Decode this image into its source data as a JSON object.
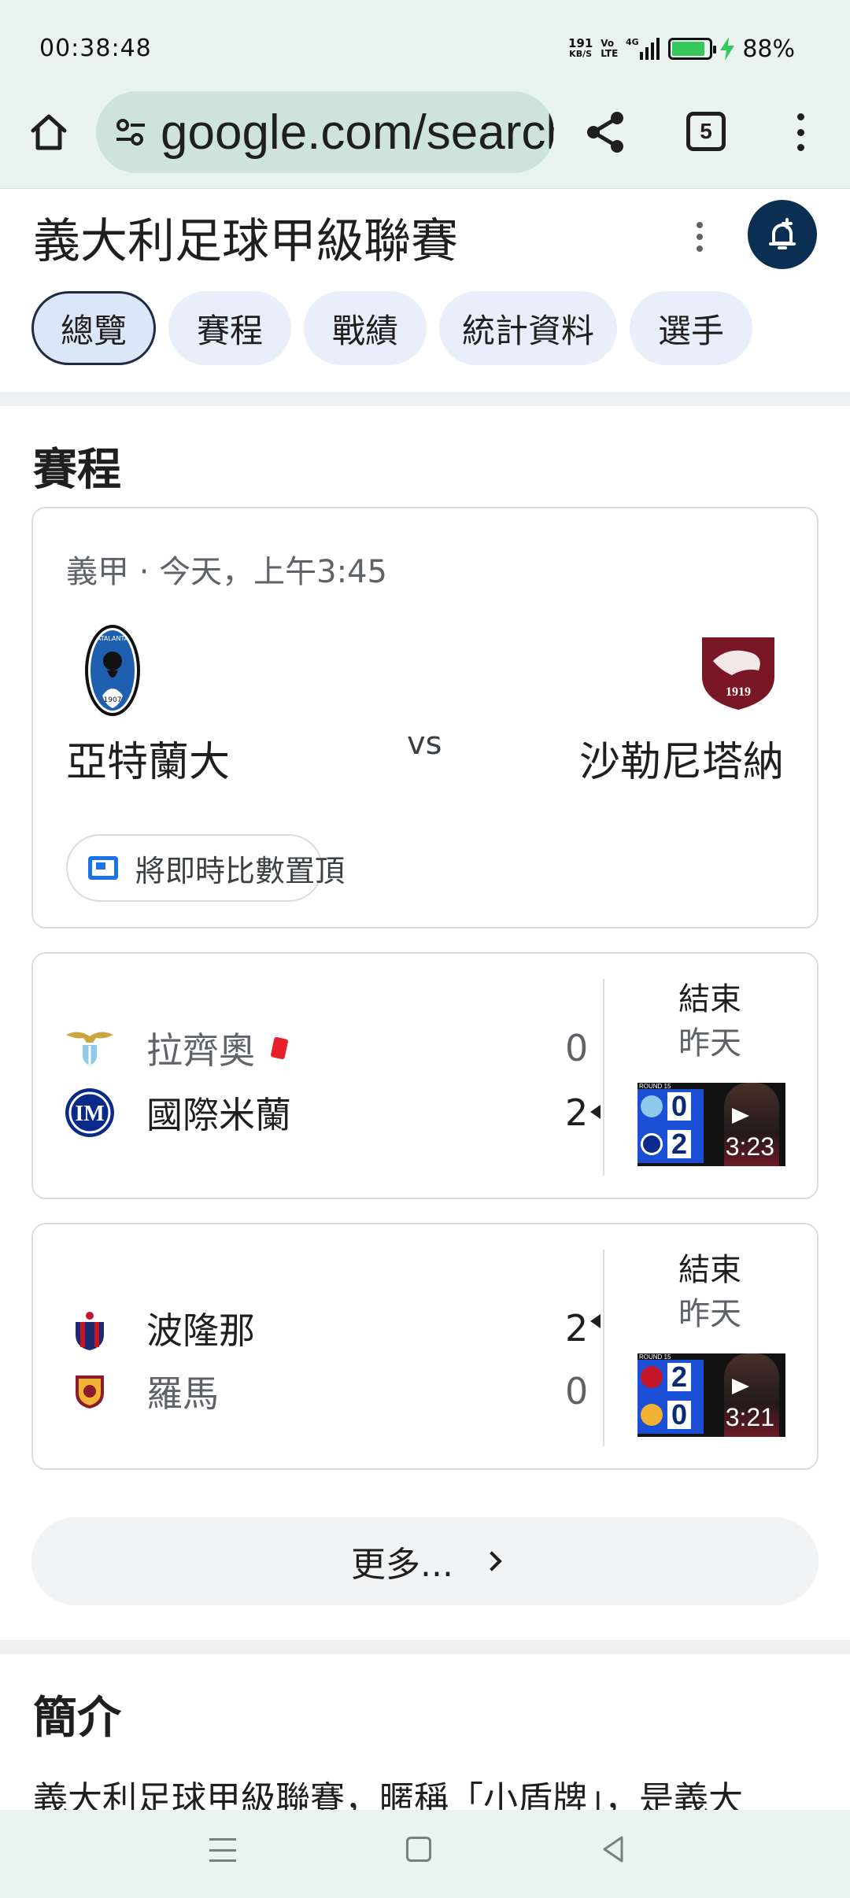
{
  "status_bar": {
    "time": "00:38:48",
    "net_speed": "191",
    "net_unit": "KB/S",
    "volte_top": "Vo",
    "volte_bottom": "LTE",
    "network": "4G",
    "battery_percent": "88%",
    "battery_level": 0.88
  },
  "browser": {
    "url": "google.com/search",
    "tab_count": "5"
  },
  "header": {
    "title": "義大利足球甲級聯賽",
    "chips": [
      "總覽",
      "賽程",
      "戰績",
      "統計資料",
      "選手"
    ],
    "active_chip": 0
  },
  "schedule": {
    "title": "賽程",
    "upcoming": {
      "meta": "義甲 · 今天，上午3:45",
      "home": "亞特蘭大",
      "away": "沙勒尼塔納",
      "vs": "vs",
      "pin_label": "將即時比數置頂",
      "home_logo_text": "ATALANTA",
      "home_logo_year": "1907",
      "away_logo_year": "1919"
    },
    "results": [
      {
        "team1": "拉齊奧",
        "score1": "0",
        "team2": "國際米蘭",
        "score2": "2",
        "status": "結束",
        "date": "昨天",
        "video_duration": "3:23",
        "thumb_score1": "0",
        "thumb_score2": "2",
        "round_label": "ROUND 15"
      },
      {
        "team1": "波隆那",
        "score1": "2",
        "team2": "羅馬",
        "score2": "0",
        "status": "結束",
        "date": "昨天",
        "video_duration": "3:21",
        "thumb_score1": "2",
        "thumb_score2": "0",
        "round_label": "ROUND 15"
      }
    ],
    "more_label": "更多..."
  },
  "intro": {
    "title": "簡介",
    "text": "義大利足球甲級聯賽，暱稱「小盾牌」，是義大"
  },
  "colors": {
    "chrome_bg": "#e9f4f1",
    "accent_navy": "#0b2f52",
    "chip_bg": "#e8eefa"
  }
}
